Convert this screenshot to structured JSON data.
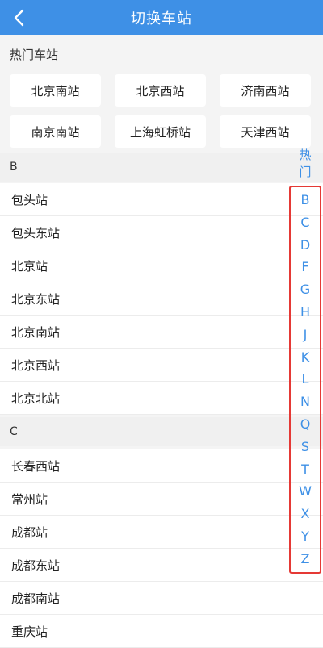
{
  "header": {
    "title": "切换车站",
    "back_icon": "chevron-left-icon"
  },
  "hot": {
    "label": "热门车站",
    "stations": [
      "北京南站",
      "北京西站",
      "济南西站",
      "南京南站",
      "上海虹桥站",
      "天津西站"
    ]
  },
  "groups": [
    {
      "letter": "B",
      "stations": [
        "包头站",
        "包头东站",
        "北京站",
        "北京东站",
        "北京南站",
        "北京西站",
        "北京北站"
      ]
    },
    {
      "letter": "C",
      "stations": [
        "长春西站",
        "常州站",
        "成都站",
        "成都东站",
        "成都南站",
        "重庆站"
      ]
    }
  ],
  "index": {
    "hot_label": "热门",
    "letters": [
      "B",
      "C",
      "D",
      "F",
      "G",
      "H",
      "J",
      "K",
      "L",
      "N",
      "Q",
      "S",
      "T",
      "W",
      "X",
      "Y",
      "Z"
    ]
  },
  "colors": {
    "accent": "#3e90e6",
    "highlight_box": "#e53935"
  }
}
